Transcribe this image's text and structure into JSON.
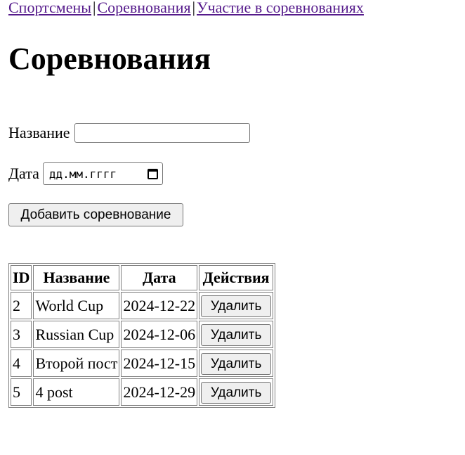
{
  "nav": {
    "athletes": "Спортсмены",
    "competitions": "Соревнования",
    "participation": "Участие в соревнованиях",
    "separator": "|"
  },
  "page_title": "Соревнования",
  "form": {
    "name_label": "Название",
    "name_value": "",
    "date_label": "Дата",
    "date_placeholder": "дд.мм.гггг",
    "submit_label": "Добавить соревнование"
  },
  "table": {
    "headers": [
      "ID",
      "Название",
      "Дата",
      "Действия"
    ],
    "delete_label": "Удалить",
    "rows": [
      {
        "id": "2",
        "name": "World Cup",
        "date": "2024-12-22"
      },
      {
        "id": "3",
        "name": "Russian Cup",
        "date": "2024-12-06"
      },
      {
        "id": "4",
        "name": "Второй пост",
        "date": "2024-12-15"
      },
      {
        "id": "5",
        "name": "4 post",
        "date": "2024-12-29"
      }
    ]
  },
  "colors": {
    "link": "#551a8b",
    "button_bg": "#efefef",
    "border": "#808080"
  }
}
